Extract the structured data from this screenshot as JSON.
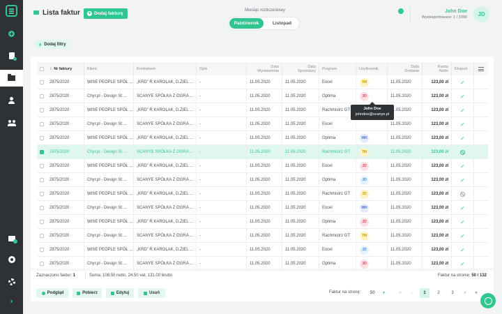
{
  "header": {
    "title": "Lista faktur",
    "add_invoice_label": "Dodaj fakturę",
    "month_label": "Miesiąc rozliczeniowy",
    "month_options": [
      "Październik",
      "Listopad"
    ],
    "user_name": "John Doe",
    "user_exported": "Wyeksportowano: 1 / 1000",
    "user_initials": "JD",
    "add_filter_label": "Dodaj filtry"
  },
  "colors": {
    "accent": "#2fc78f",
    "sidebar": "#2e3236"
  },
  "table": {
    "columns": {
      "number": "Nr faktury",
      "client": "Klient",
      "contractor": "Kontrahent",
      "desc": "Opis",
      "issue_date": [
        "Data",
        "Wystawienia"
      ],
      "sale_date": [
        "Data",
        "Sprzedaży"
      ],
      "program": "Program",
      "user": "Użytkownik",
      "added_date": [
        "Data",
        "Dodania"
      ],
      "net_amount": [
        "Kwota",
        "Netto"
      ],
      "export": "Eksport"
    },
    "rows": [
      {
        "number": "2875/2020",
        "client": "WISE PEOPLE SPÓŁ ...",
        "contractor": "„KRD” R.KAROLAK, D.ZIEL ...",
        "desc": "-",
        "issue": "11.05.2020",
        "sale": "11.05.2020",
        "program": "Excel",
        "user": "TM",
        "user_bg": "#fdf3c4",
        "user_fg": "#c9a200",
        "added": "11.05.2020",
        "amount": "123,00 zł",
        "export": "ok",
        "selected": false
      },
      {
        "number": "2875/2020",
        "client": "Chyr.pl - Design St ...",
        "contractor": "SCANYE SPÓŁKA Z OGRA ...",
        "desc": "-",
        "issue": "11.05.2020",
        "sale": "11.05.2020",
        "program": "Optima",
        "user": "JD",
        "user_bg": "#fde0e4",
        "user_fg": "#e0405a",
        "added": "11.05.2020",
        "amount": "123,00 zł",
        "export": "ok",
        "selected": false
      },
      {
        "number": "2875/2020",
        "client": "WISE PEOPLE SPÓŁ ...",
        "contractor": "„KRD” R.KAROLAK, D.ZIEL ...",
        "desc": "-",
        "issue": "11.05.2020",
        "sale": "11.05.2020",
        "program": "Rachmistrz GT",
        "user": "",
        "user_bg": "",
        "user_fg": "",
        "added": "11.05.2020",
        "amount": "123,00 zł",
        "export": "ok",
        "selected": false
      },
      {
        "number": "2875/2020",
        "client": "Chyr.pl - Design St ...",
        "contractor": "SCANYE SPÓŁKA Z OGRA ...",
        "desc": "-",
        "issue": "11.05.2020",
        "sale": "11.05.2020",
        "program": "Excel",
        "user": "",
        "user_bg": "",
        "user_fg": "",
        "added": "11.05.2020",
        "amount": "123,00 zł",
        "export": "ok",
        "selected": false
      },
      {
        "number": "2875/2020",
        "client": "WISE PEOPLE SPÓŁ ...",
        "contractor": "„KRD” R.KAROLAK, D.ZIEL ...",
        "desc": "-",
        "issue": "11.05.2020",
        "sale": "11.05.2020",
        "program": "Optima",
        "user": "WH",
        "user_bg": "#e3eafc",
        "user_fg": "#4a6fd8",
        "added": "11.05.2020",
        "amount": "123,00 zł",
        "export": "ok",
        "selected": false
      },
      {
        "number": "2875/2020",
        "client": "Chyr.pl - Design St ...",
        "contractor": "SCANYE SPÓŁKA Z OGRA ...",
        "desc": "-",
        "issue": "11.05.2020",
        "sale": "11.05.2020",
        "program": "Rachmistrz GT",
        "user": "TM",
        "user_bg": "#fdf3c4",
        "user_fg": "#c9a200",
        "added": "11.05.2020",
        "amount": "123,00 zł",
        "export": "ban",
        "selected": true
      },
      {
        "number": "2875/2020",
        "client": "WISE PEOPLE SPÓŁ ...",
        "contractor": "„KRD” R.KAROLAK, D.ZIEL ...",
        "desc": "-",
        "issue": "11.05.2020",
        "sale": "11.05.2020",
        "program": "Excel",
        "user": "JD",
        "user_bg": "#fde0e4",
        "user_fg": "#e0405a",
        "added": "11.05.2020",
        "amount": "123,00 zł",
        "export": "ok",
        "selected": false
      },
      {
        "number": "2875/2020",
        "client": "Chyr.pl - Design St ...",
        "contractor": "SCANYE SPÓŁKA Z OGRA ...",
        "desc": "-",
        "issue": "11.05.2020",
        "sale": "11.05.2020",
        "program": "Optima",
        "user": "JD",
        "user_bg": "#e3f1fc",
        "user_fg": "#3a8fd8",
        "added": "11.05.2020",
        "amount": "123,00 zł",
        "export": "ok",
        "selected": false
      },
      {
        "number": "2875/2020",
        "client": "WISE PEOPLE SPÓŁ ...",
        "contractor": "„KRD” R.KAROLAK, D.ZIEL ...",
        "desc": "-",
        "issue": "11.05.2020",
        "sale": "11.05.2020",
        "program": "Rachmistrz GT",
        "user": "JD",
        "user_bg": "#fdf3c4",
        "user_fg": "#c9a200",
        "added": "11.05.2020",
        "amount": "123,00 zł",
        "export": "ban",
        "selected": false
      },
      {
        "number": "2875/2020",
        "client": "Chyr.pl - Design St ...",
        "contractor": "SCANYE SPÓŁKA Z OGRA ...",
        "desc": "-",
        "issue": "11.05.2020",
        "sale": "11.05.2020",
        "program": "Excel",
        "user": "WH",
        "user_bg": "#e3eafc",
        "user_fg": "#4a6fd8",
        "added": "11.05.2020",
        "amount": "123,00 zł",
        "export": "ok",
        "selected": false
      },
      {
        "number": "2875/2020",
        "client": "WISE PEOPLE SPÓŁ ...",
        "contractor": "„KRD” R.KAROLAK, D.ZIEL ...",
        "desc": "-",
        "issue": "11.05.2020",
        "sale": "11.05.2020",
        "program": "Optima",
        "user": "JD",
        "user_bg": "#fde0e4",
        "user_fg": "#e0405a",
        "added": "11.05.2020",
        "amount": "123,00 zł",
        "export": "ok",
        "selected": false
      },
      {
        "number": "2875/2020",
        "client": "Chyr.pl - Design St ...",
        "contractor": "SCANYE SPÓŁKA Z OGRA ...",
        "desc": "-",
        "issue": "11.05.2020",
        "sale": "11.05.2020",
        "program": "Rachmistrz GT",
        "user": "TM",
        "user_bg": "#fdf3c4",
        "user_fg": "#c9a200",
        "added": "11.05.2020",
        "amount": "123,00 zł",
        "export": "ok",
        "selected": false
      },
      {
        "number": "2875/2020",
        "client": "WISE PEOPLE SPÓŁ ...",
        "contractor": "„KRD” R.KAROLAK, D.ZIEL ...",
        "desc": "-",
        "issue": "11.05.2020",
        "sale": "11.05.2020",
        "program": "Excel",
        "user": "JD",
        "user_bg": "#e3f1fc",
        "user_fg": "#3a8fd8",
        "added": "11.05.2020",
        "amount": "123,00 zł",
        "export": "ok",
        "selected": false
      },
      {
        "number": "2875/2020",
        "client": "Chyr.pl - Design St ...",
        "contractor": "SCANYE SPÓŁKA Z OGRA ...",
        "desc": "-",
        "issue": "11.05.2020",
        "sale": "11.05.2020",
        "program": "Optima",
        "user": "JD",
        "user_bg": "#fde0e4",
        "user_fg": "#e0405a",
        "added": "11.05.2020",
        "amount": "123,00 zł",
        "export": "ok",
        "selected": false
      }
    ]
  },
  "tooltip": {
    "name": "John Doe",
    "email": "johndoe@scanye.pl"
  },
  "summary": {
    "selected_label": "Zaznaczono faktur:",
    "selected_count": "1",
    "sum_label": "Suma:",
    "sum_value": "108.50 netto, 24.50 vat, 131.00 brutto",
    "per_page_label": "Faktur na stronie:",
    "per_page_value": "50 / 132"
  },
  "actions": {
    "preview": "Podgląd",
    "download": "Pobierz",
    "edit": "Edytuj",
    "delete": "Usuń"
  },
  "pagination": {
    "per_page_label": "Faktur na stronę:",
    "per_page_value": "50",
    "pages": [
      "1",
      "2",
      "3"
    ],
    "current": "1",
    "first": "«",
    "prev": "‹",
    "next": "›",
    "last": "»"
  }
}
